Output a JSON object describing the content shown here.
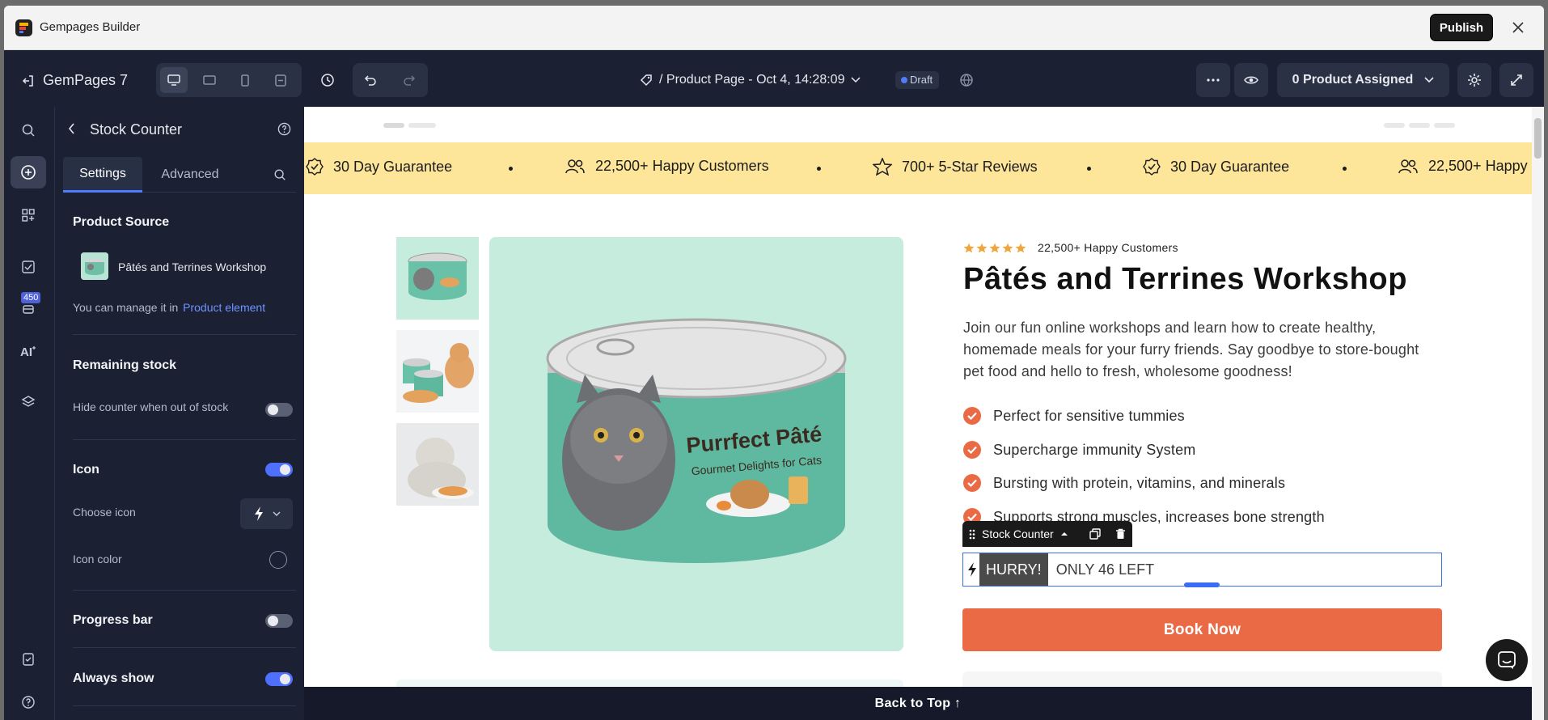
{
  "window": {
    "title": "Gempages Builder",
    "publish_label": "Publish"
  },
  "toolbar": {
    "back_label": "GemPages 7",
    "page_title": "/ Product Page - Oct 4, 14:28:09",
    "draft_label": "Draft",
    "product_assigned": "0 Product Assigned"
  },
  "rail": {
    "badge": "450"
  },
  "panel": {
    "title": "Stock Counter",
    "tabs": [
      "Settings",
      "Advanced"
    ],
    "product_source": {
      "title": "Product Source",
      "product_name": "Pâtés and Terrines Workshop",
      "manage_text": "You can manage it in",
      "manage_link": "Product element"
    },
    "remaining_stock": {
      "title": "Remaining stock",
      "hide_label": "Hide counter when out of stock",
      "hide_on": false
    },
    "icon": {
      "title": "Icon",
      "on": true,
      "choose_label": "Choose icon",
      "color_label": "Icon color"
    },
    "progress_bar": {
      "title": "Progress bar",
      "on": false
    },
    "always_show": {
      "title": "Always show",
      "on": true
    }
  },
  "marquee": {
    "items": [
      "30 Day Guarantee",
      "22,500+ Happy Customers",
      "700+ 5-Star Reviews",
      "30 Day Guarantee",
      "22,500+ Happy C"
    ]
  },
  "product": {
    "review_text": "22,500+ Happy Customers",
    "title": "Pâtés and Terrines Workshop",
    "description": "Join our fun online workshops and learn how to create healthy, homemade meals for your furry friends. Say goodbye to store-bought pet food and hello to fresh, wholesome goodness!",
    "features": [
      "Perfect for sensitive tummies",
      "Supercharge immunity System",
      "Bursting with protein, vitamins, and minerals",
      "Supports strong muscles, increases bone strength"
    ],
    "can_brand": "Purrfect Pâté",
    "can_sub": "Gourmet Delights for Cats"
  },
  "stock_counter": {
    "label": "Stock Counter",
    "hurry": "HURRY!",
    "only_left": "ONLY 46 LEFT"
  },
  "cta": {
    "book_now": "Book Now",
    "back_to_top": "Back to Top ↑"
  },
  "colors": {
    "accent": "#ea6a45",
    "marquee_bg": "#fde59a",
    "editor_dark": "#1b2133",
    "selection_blue": "#3a6cf4"
  }
}
